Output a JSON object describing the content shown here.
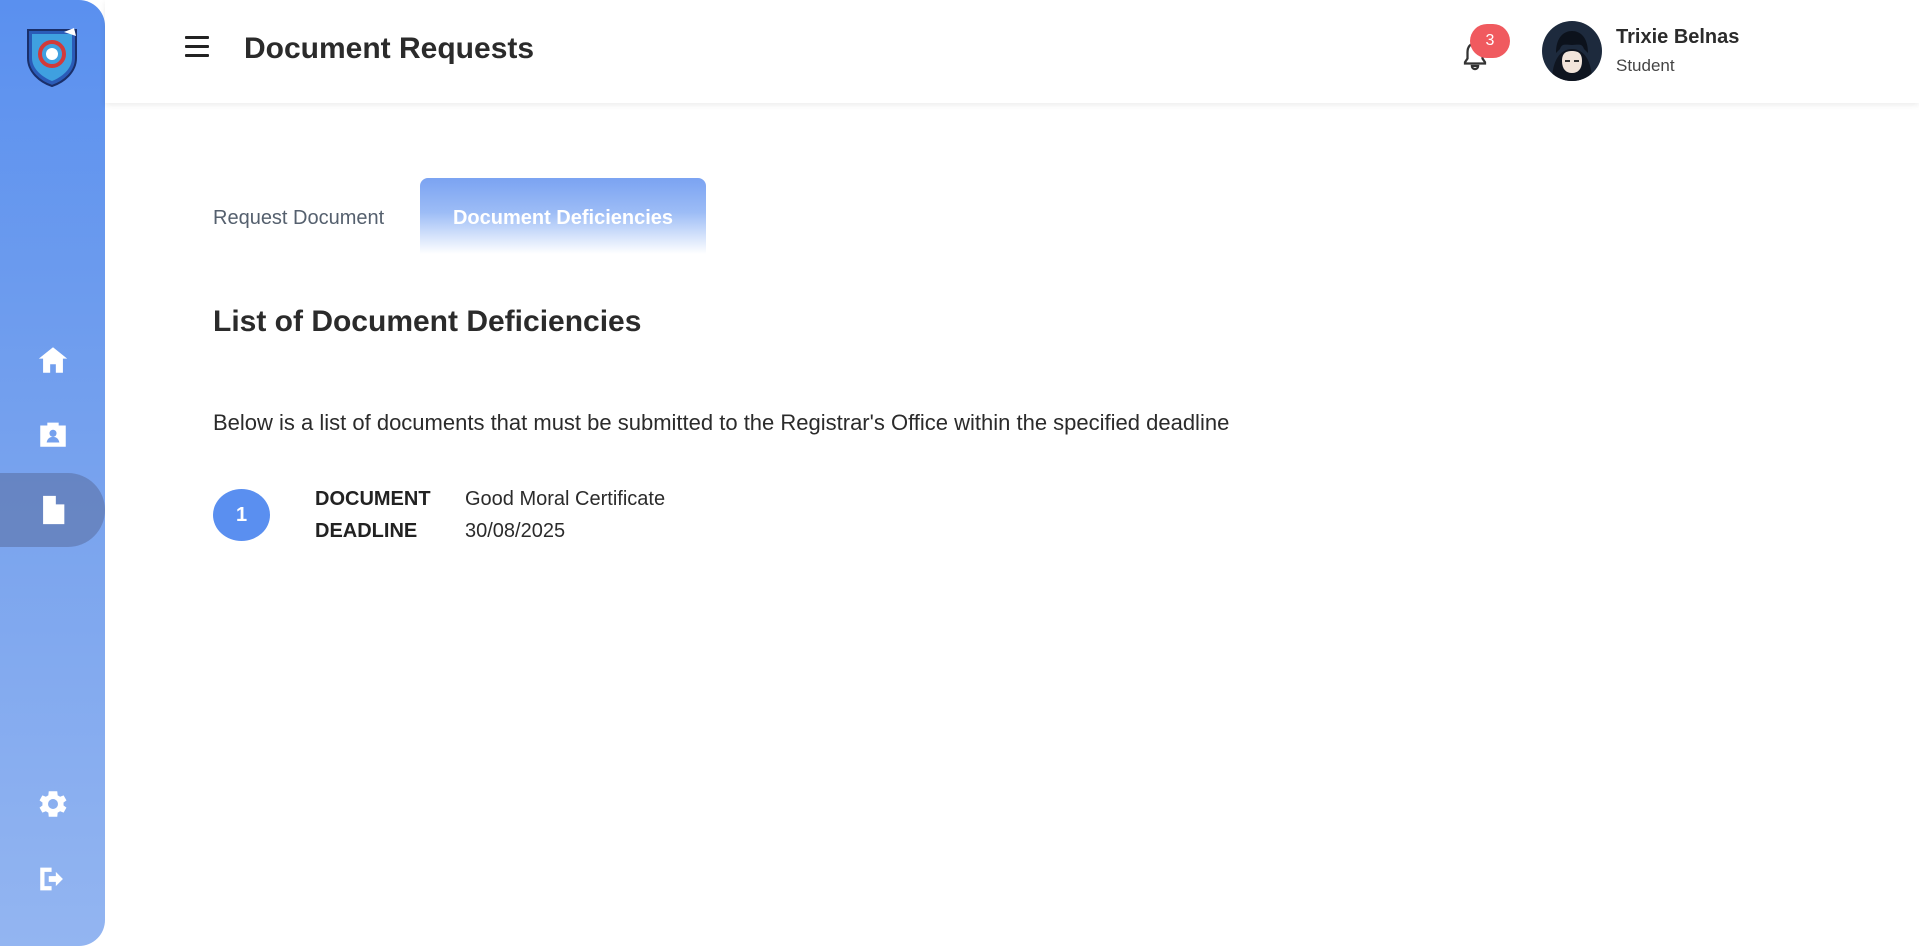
{
  "header": {
    "title": "Document Requests",
    "notification_count": "3",
    "user_name": "Trixie Belnas",
    "user_role": "Student"
  },
  "sidebar": {
    "items": [
      {
        "icon": "home-icon"
      },
      {
        "icon": "id-badge-icon"
      },
      {
        "icon": "document-icon",
        "active": true
      },
      {
        "icon": "gear-icon"
      },
      {
        "icon": "logout-icon"
      }
    ]
  },
  "tabs": [
    {
      "label": "Request Document",
      "active": false
    },
    {
      "label": "Document Deficiencies",
      "active": true
    }
  ],
  "main": {
    "section_title": "List of Document Deficiencies",
    "intro": "Below is a list of documents that must be submitted to the Registrar's Office within the specified deadline",
    "deficiencies": [
      {
        "number": "1",
        "document_label": "DOCUMENT",
        "document": "Good Moral Certificate",
        "deadline_label": "DEADLINE",
        "deadline": "30/08/2025"
      }
    ]
  },
  "colors": {
    "accent": "#5a8ff0",
    "badge": "#f05a5f"
  }
}
